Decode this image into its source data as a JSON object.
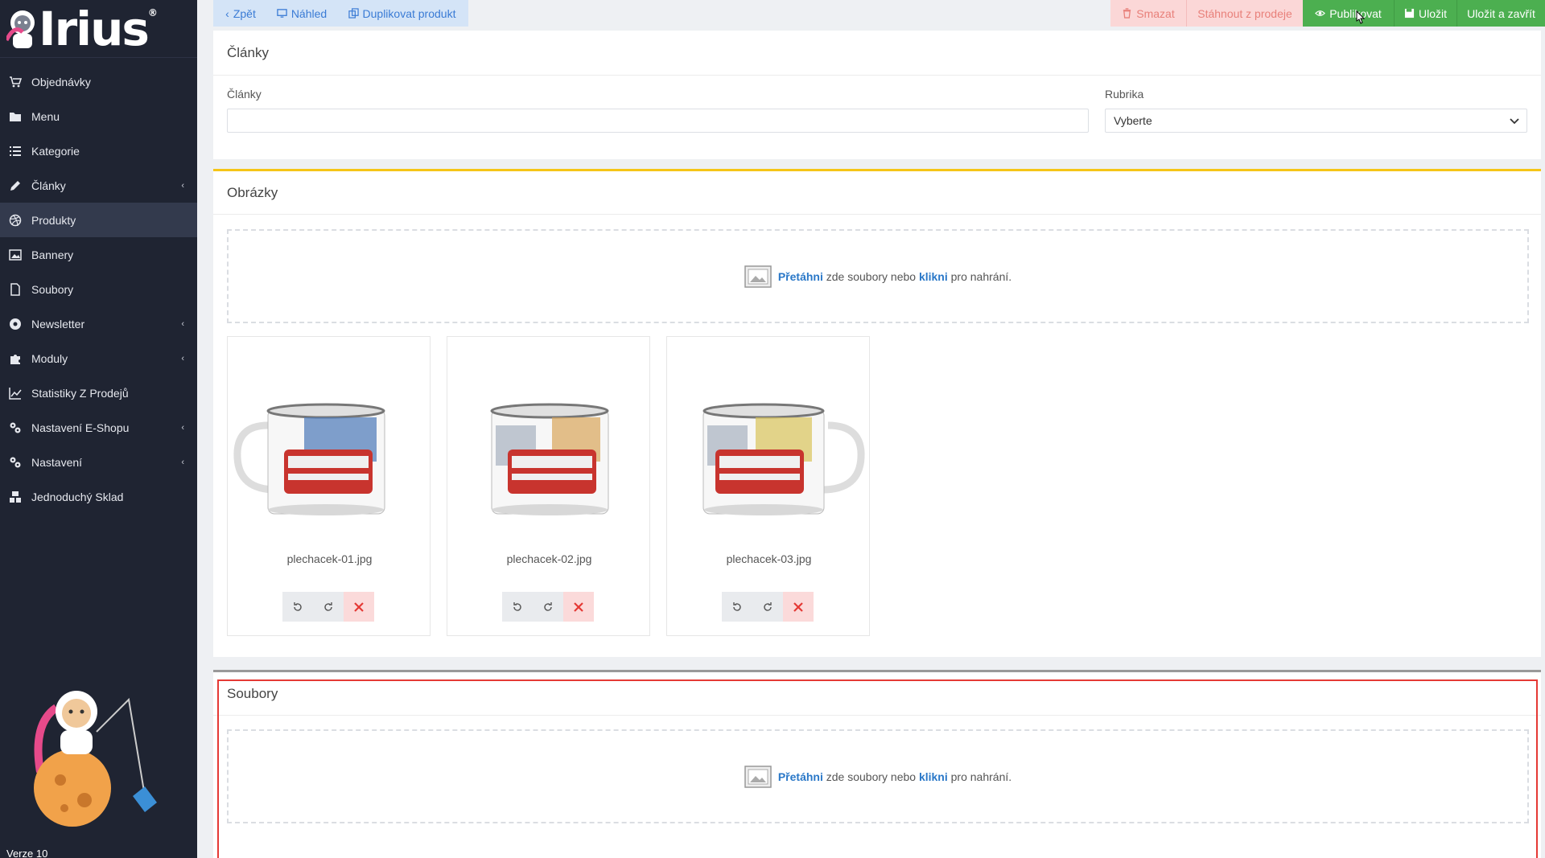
{
  "app": {
    "logo_text": "Irius",
    "version": "Verze 10"
  },
  "sidebar": {
    "items": [
      {
        "label": "Objednávky",
        "icon": "cart-icon",
        "has_submenu": false
      },
      {
        "label": "Menu",
        "icon": "folder-icon",
        "has_submenu": false
      },
      {
        "label": "Kategorie",
        "icon": "list-icon",
        "has_submenu": false
      },
      {
        "label": "Články",
        "icon": "pencil-icon",
        "has_submenu": true
      },
      {
        "label": "Produkty",
        "icon": "dribbble-icon",
        "has_submenu": false,
        "active": true
      },
      {
        "label": "Bannery",
        "icon": "image-icon",
        "has_submenu": false
      },
      {
        "label": "Soubory",
        "icon": "file-icon",
        "has_submenu": false
      },
      {
        "label": "Newsletter",
        "icon": "at-icon",
        "has_submenu": true
      },
      {
        "label": "Moduly",
        "icon": "puzzle-icon",
        "has_submenu": true
      },
      {
        "label": "Statistiky Z Prodejů",
        "icon": "line-chart-icon",
        "has_submenu": false
      },
      {
        "label": "Nastavení E-Shopu",
        "icon": "gears-icon",
        "has_submenu": true
      },
      {
        "label": "Nastavení",
        "icon": "gears-icon",
        "has_submenu": true
      },
      {
        "label": "Jednoduchý Sklad",
        "icon": "boxes-icon",
        "has_submenu": false
      }
    ]
  },
  "toolbar": {
    "back": "Zpět",
    "preview": "Náhled",
    "duplicate": "Duplikovat produkt",
    "delete": "Smazat",
    "withdraw": "Stáhnout z prodeje",
    "publish": "Publikovat",
    "save": "Uložit",
    "save_close": "Uložit a zavřít"
  },
  "articles": {
    "title": "Články",
    "articles_label": "Články",
    "articles_value": "",
    "rubric_label": "Rubrika",
    "rubric_value": "Vyberte"
  },
  "images": {
    "title": "Obrázky",
    "dropzone": {
      "drag": "Přetáhni",
      "middle": " zde soubory nebo ",
      "click": "klikni",
      "end": " pro nahrání."
    },
    "files": [
      {
        "name": "plechacek-01.jpg",
        "handle": "right"
      },
      {
        "name": "plechacek-02.jpg",
        "handle": "none"
      },
      {
        "name": "plechacek-03.jpg",
        "handle": "right"
      }
    ]
  },
  "files_section": {
    "title": "Soubory",
    "dropzone": {
      "drag": "Přetáhni",
      "middle": " zde soubory nebo ",
      "click": "klikni",
      "end": " pro nahrání."
    }
  },
  "colors": {
    "sidebar_bg": "#1f2432",
    "accent_blue": "#2a78c8",
    "publish_green": "#4caf50",
    "danger_bg": "#fbd7d7",
    "section_yellow": "#f5c518",
    "highlight_red": "#e53935"
  }
}
